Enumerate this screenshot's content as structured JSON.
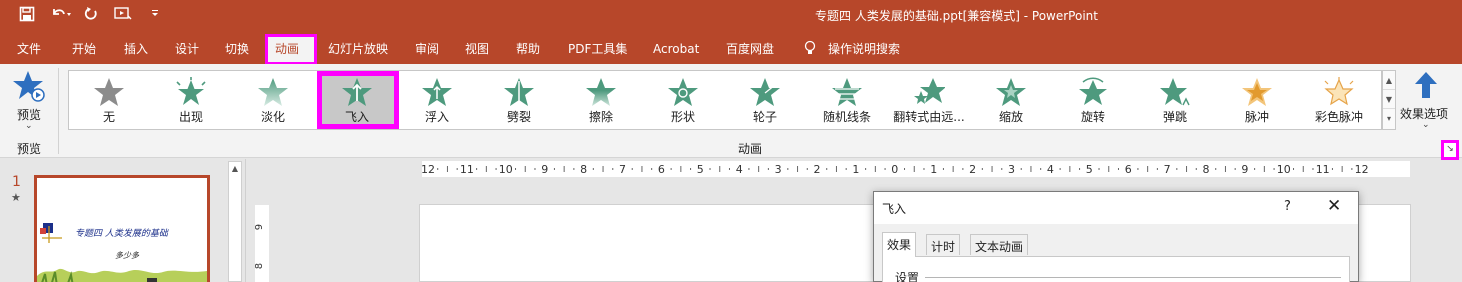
{
  "titlebar": {
    "title": "专题四 人类发展的基础.ppt[兼容模式] - PowerPoint",
    "qat": {
      "save": "save-icon",
      "undo": "undo-icon",
      "redo": "redo-icon",
      "present": "present-from-start-icon",
      "customize": "customize-icon"
    }
  },
  "tabs": [
    {
      "label": "文件"
    },
    {
      "label": "开始"
    },
    {
      "label": "插入"
    },
    {
      "label": "设计"
    },
    {
      "label": "切换"
    },
    {
      "label": "动画"
    },
    {
      "label": "幻灯片放映"
    },
    {
      "label": "审阅"
    },
    {
      "label": "视图"
    },
    {
      "label": "帮助"
    },
    {
      "label": "PDF工具集"
    },
    {
      "label": "Acrobat"
    },
    {
      "label": "百度网盘"
    },
    {
      "label": "操作说明搜索"
    }
  ],
  "ribbon": {
    "preview_label": "预览",
    "preview_group": "预览",
    "animation_group": "动画",
    "effect_options": "效果选项",
    "effects": [
      {
        "label": "无"
      },
      {
        "label": "出现"
      },
      {
        "label": "淡化"
      },
      {
        "label": "飞入"
      },
      {
        "label": "浮入"
      },
      {
        "label": "劈裂"
      },
      {
        "label": "擦除"
      },
      {
        "label": "形状"
      },
      {
        "label": "轮子"
      },
      {
        "label": "随机线条"
      },
      {
        "label": "翻转式由远..."
      },
      {
        "label": "缩放"
      },
      {
        "label": "旋转"
      },
      {
        "label": "弹跳"
      },
      {
        "label": "脉冲"
      },
      {
        "label": "彩色脉冲"
      }
    ],
    "selected_effect": "飞入",
    "colors": {
      "accent": "#b7472a",
      "highlight": "#ff00ff",
      "star": "#4e9a7e"
    }
  },
  "ruler": {
    "ticks": [
      "12",
      "11",
      "10",
      "9",
      "8",
      "7",
      "6",
      "5",
      "4",
      "3",
      "2",
      "1",
      "0",
      "1",
      "2",
      "3",
      "4",
      "5",
      "6",
      "7",
      "8",
      "9",
      "10",
      "11",
      "12"
    ],
    "vticks": [
      "9",
      "8"
    ]
  },
  "slides": {
    "number": "1",
    "star": "★",
    "thumb_title": "专题四 人类发展的基础",
    "thumb_author": "多少多"
  },
  "dialog": {
    "title": "飞入",
    "help": "?",
    "close": "✕",
    "tabs": [
      {
        "label": "效果"
      },
      {
        "label": "计时"
      },
      {
        "label": "文本动画"
      }
    ],
    "section": "设置"
  }
}
